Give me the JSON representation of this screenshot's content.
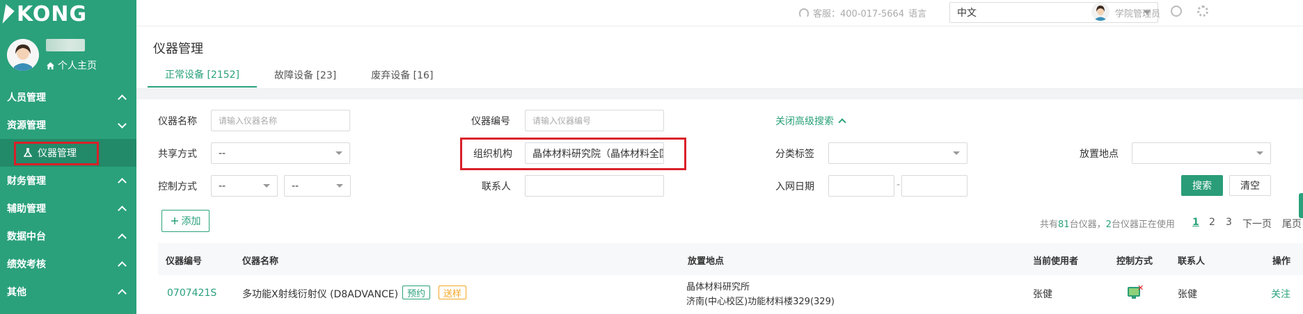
{
  "brand": {
    "logo_text": "KONG"
  },
  "sidebar": {
    "home_label": "个人主页",
    "items": [
      {
        "label": "人员管理",
        "expanded": false
      },
      {
        "label": "资源管理",
        "expanded": true,
        "sub": [
          {
            "label": "仪器管理",
            "active": true
          }
        ]
      },
      {
        "label": "财务管理",
        "expanded": false
      },
      {
        "label": "辅助管理",
        "expanded": false
      },
      {
        "label": "数据中台",
        "expanded": false
      },
      {
        "label": "绩效考核",
        "expanded": false
      },
      {
        "label": "其他",
        "expanded": false
      }
    ]
  },
  "topbar": {
    "service": "客服：400-017-5664",
    "language_label": "语言",
    "language_value": "中文",
    "user": "学院管理员"
  },
  "page": {
    "title": "仪器管理",
    "tabs": [
      {
        "label": "正常设备 [2152]",
        "active": true
      },
      {
        "label": "故障设备 [23]",
        "active": false
      },
      {
        "label": "废弃设备 [16]",
        "active": false
      }
    ]
  },
  "search": {
    "name_label": "仪器名称",
    "name_placeholder": "请输入仪器名称",
    "code_label": "仪器编号",
    "code_placeholder": "请输入仪器编号",
    "advanced_toggle": "关闭高级搜索",
    "share_label": "共享方式",
    "share_value": "--",
    "org_label": "组织机构",
    "org_value": "晶体材料研究院（晶体材料全国",
    "category_label": "分类标签",
    "category_value": "",
    "location_label": "放置地点",
    "location_value": "",
    "control_label": "控制方式",
    "control_value_1": "--",
    "control_value_2": "--",
    "contact_label": "联系人",
    "contact_value": "",
    "date_label": "入网日期",
    "date_sep": "-",
    "search_button": "搜索",
    "clear_button": "清空"
  },
  "toolbar": {
    "add_button": "添加",
    "summary_prefix": "共有",
    "summary_count": "81",
    "summary_mid": "台仪器，",
    "summary_inuse": "2",
    "summary_suffix": "台仪器正在使用",
    "pages": [
      "1",
      "2",
      "3"
    ],
    "current_page": "1",
    "next": "下一页",
    "last": "尾页"
  },
  "table": {
    "headers": [
      "仪器编号",
      "仪器名称",
      "放置地点",
      "当前使用者",
      "控制方式",
      "联系人",
      "操作"
    ],
    "rows": [
      {
        "code": "0707421S",
        "name": "多功能X射线衍射仪 (D8ADVANCE)",
        "tags": [
          "预约",
          "送样"
        ],
        "location_line1": "晶体材料研究所",
        "location_line2": "济南(中心校区)功能材料楼329(329)",
        "user": "张健",
        "contact": "张健",
        "action": "关注"
      }
    ]
  }
}
